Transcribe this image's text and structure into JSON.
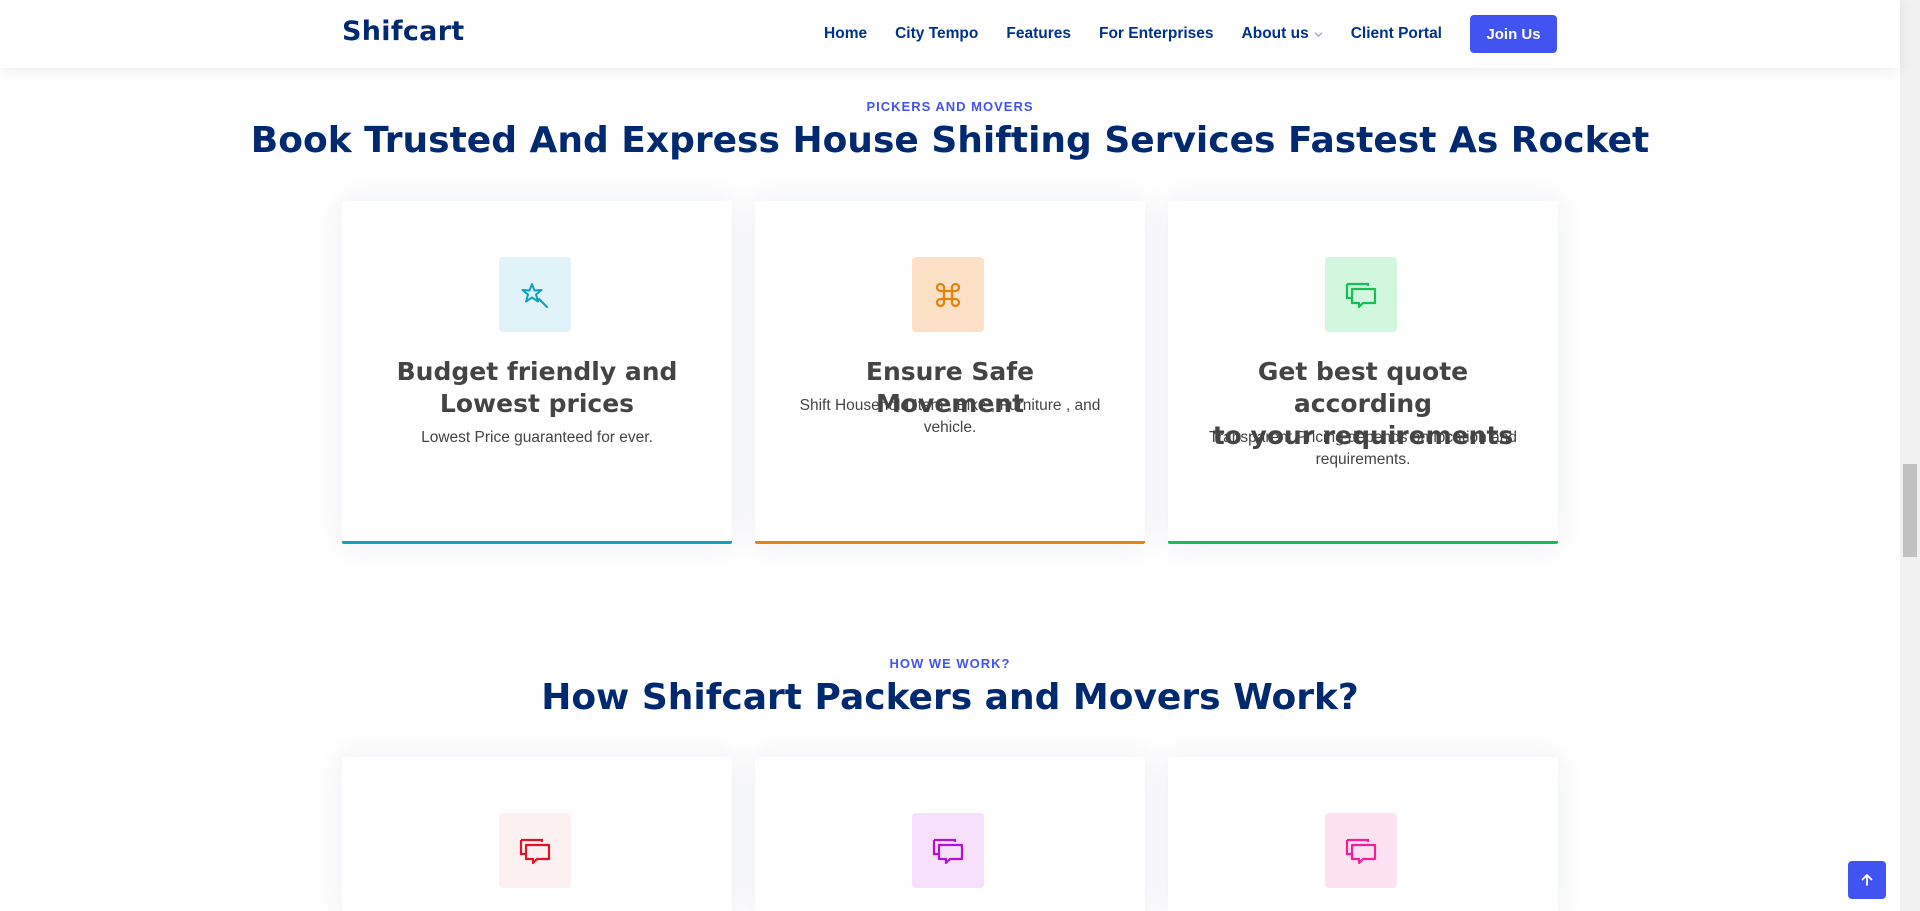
{
  "header": {
    "brand": "Shifcart",
    "nav": [
      "Home",
      "City Tempo",
      "Features",
      "For Enterprises",
      "About us",
      "Client Portal"
    ],
    "cta": "Join Us"
  },
  "section1": {
    "label": "PICKERS AND MOVERS",
    "title": "Book Trusted And Express House Shifting Services Fastest As Rocket",
    "cards": [
      {
        "icon": "magic-star-icon",
        "title_line1": "Budget friendly and",
        "title_line2": "Lowest prices",
        "desc": "Lowest Price guaranteed for ever.",
        "color": "#0ea2bd",
        "icon_bg": "#e0f3f9"
      },
      {
        "icon": "command-icon",
        "title_line1": "Ensure Safe Movement",
        "title_line2": "",
        "desc_line1": "Shift Household Item , Bike , Furniture , and",
        "desc_line2": "vehicle.",
        "color": "#e48410",
        "icon_bg": "#fce1c6"
      },
      {
        "icon": "chat-icon",
        "title_line1": "Get best quote according",
        "title_line2": "to your requirements",
        "desc_line1": "Transparent Pricing depends on location and",
        "desc_line2": "requirements.",
        "color": "#15be56",
        "icon_bg": "#d2f7df"
      }
    ]
  },
  "section2": {
    "label": "HOW WE WORK?",
    "title": "How Shifcart Packers and Movers Work?",
    "cards": [
      {
        "icon": "chat-icon",
        "color": "#df1529",
        "icon_bg": "#fdf0f1"
      },
      {
        "icon": "chat-icon",
        "color": "#b50edf",
        "icon_bg": "#f7e0fc"
      },
      {
        "icon": "chat-icon",
        "color": "#f51f9c",
        "icon_bg": "#fde3f2"
      }
    ]
  }
}
